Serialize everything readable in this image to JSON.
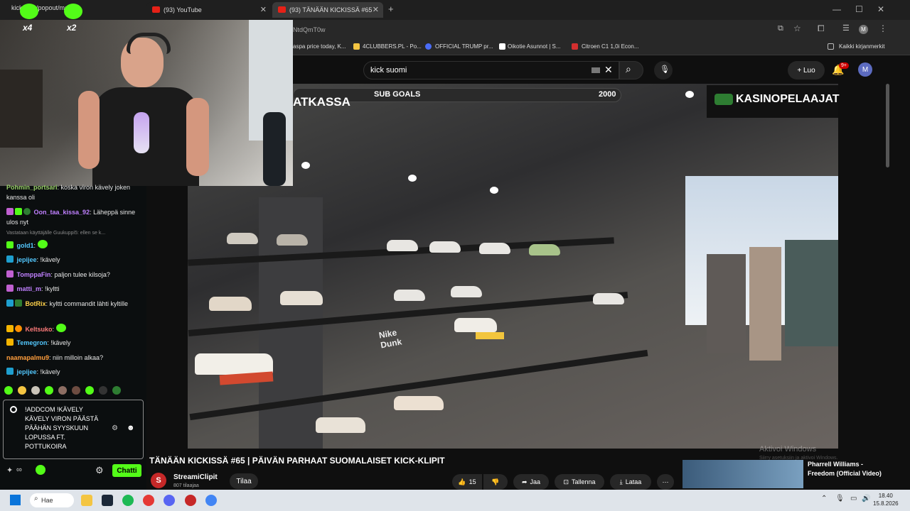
{
  "browser": {
    "tabs": [
      {
        "label": "kick.com/popout/mo"
      },
      {
        "label": "(93) YouTube"
      },
      {
        "label": "(93) TÄNÄÄN KICKISSÄ #65 | PÄ"
      }
    ],
    "url": "NtdQmT0w",
    "bookmarks": [
      "aspa price today, K...",
      "4CLUBBERS.PL - Po...",
      "OFFICIAL TRUMP pr...",
      "Oikotie Asunnot | S...",
      "Citroen C1 1,0i Econ...",
      "Kaikki kirjanmerkit"
    ],
    "profile_initial": "M"
  },
  "youtube": {
    "search_value": "kick suomi",
    "create_label": "Luo",
    "notif_count": "9+",
    "avatar_initial": "M",
    "overlay": {
      "subgoals_label": "SUB GOALS",
      "subgoals_value": "2000",
      "left_text": "ATKASSA",
      "sponsor": "KASINOPELAAJAT"
    },
    "video_title": "TÄNÄÄN KICKISSÄ #65 | PÄIVÄN PARHAAT SUOMALAISET KICK-KLIPIT",
    "channel_name": "StreamiClipit",
    "channel_initial": "S",
    "subs": "807 tilaajaa",
    "subscribe_label": "Tilaa",
    "likes": "15",
    "share_label": "Jaa",
    "save_label": "Tallenna",
    "download_label": "Lataa",
    "rec_title": "Pharrell Williams - Freedom (Official Video)",
    "watermark": "Aktivoi Windows",
    "watermark_sub": "Siirry asetuksiin ja aktivoi Windows."
  },
  "chat": {
    "multiplier_a": "x4",
    "multiplier_b": "x2",
    "messages": [
      {
        "user": "Pohmin_portsari",
        "color": "#9ad06a",
        "text": ": koska viron kävely joken kanssa oli"
      },
      {
        "user": "Oon_taa_kissa_92",
        "color": "#c080ff",
        "text": ": Läheppä sinne ulos nyt"
      },
      {
        "user": "gold1",
        "color": "#53c8ff",
        "text": ":"
      },
      {
        "user": "jepijee",
        "color": "#53c8ff",
        "text": ": !kävely"
      },
      {
        "user": "TomppaFin",
        "color": "#c080ff",
        "text": ": paljon tulee kilsoja?"
      },
      {
        "user": "matti_m",
        "color": "#c080ff",
        "text": ": !kyltti"
      },
      {
        "user": "BotRix",
        "color": "#ffd24a",
        "text": ": kyltti commandit lähti kyltille"
      },
      {
        "user": "Keltsuko",
        "color": "#ff7b7b",
        "text": ":"
      },
      {
        "user": "Temegron",
        "color": "#53c8ff",
        "text": ": !kävely"
      },
      {
        "user": "naamapalmu9",
        "color": "#ff9e3d",
        "text": ": niin milloin alkaa?"
      },
      {
        "user": "jepijee",
        "color": "#53c8ff",
        "text": ": !kävely"
      }
    ],
    "reply_note": "Vastataan käyttäjälle Guukuppi5: ellen se k...",
    "input_text": "!ADDCOM !KÄVELY KÄVELY VIRON PÄÄSTÄ PÄÄHÄN SYYSKUUN LOPUSSA FT. POTTUKOIRA",
    "send_label": "Chatti",
    "accent": "#53fc18"
  },
  "taskbar": {
    "search_label": "Hae",
    "time": "18.40",
    "date": "15.8.2026"
  }
}
